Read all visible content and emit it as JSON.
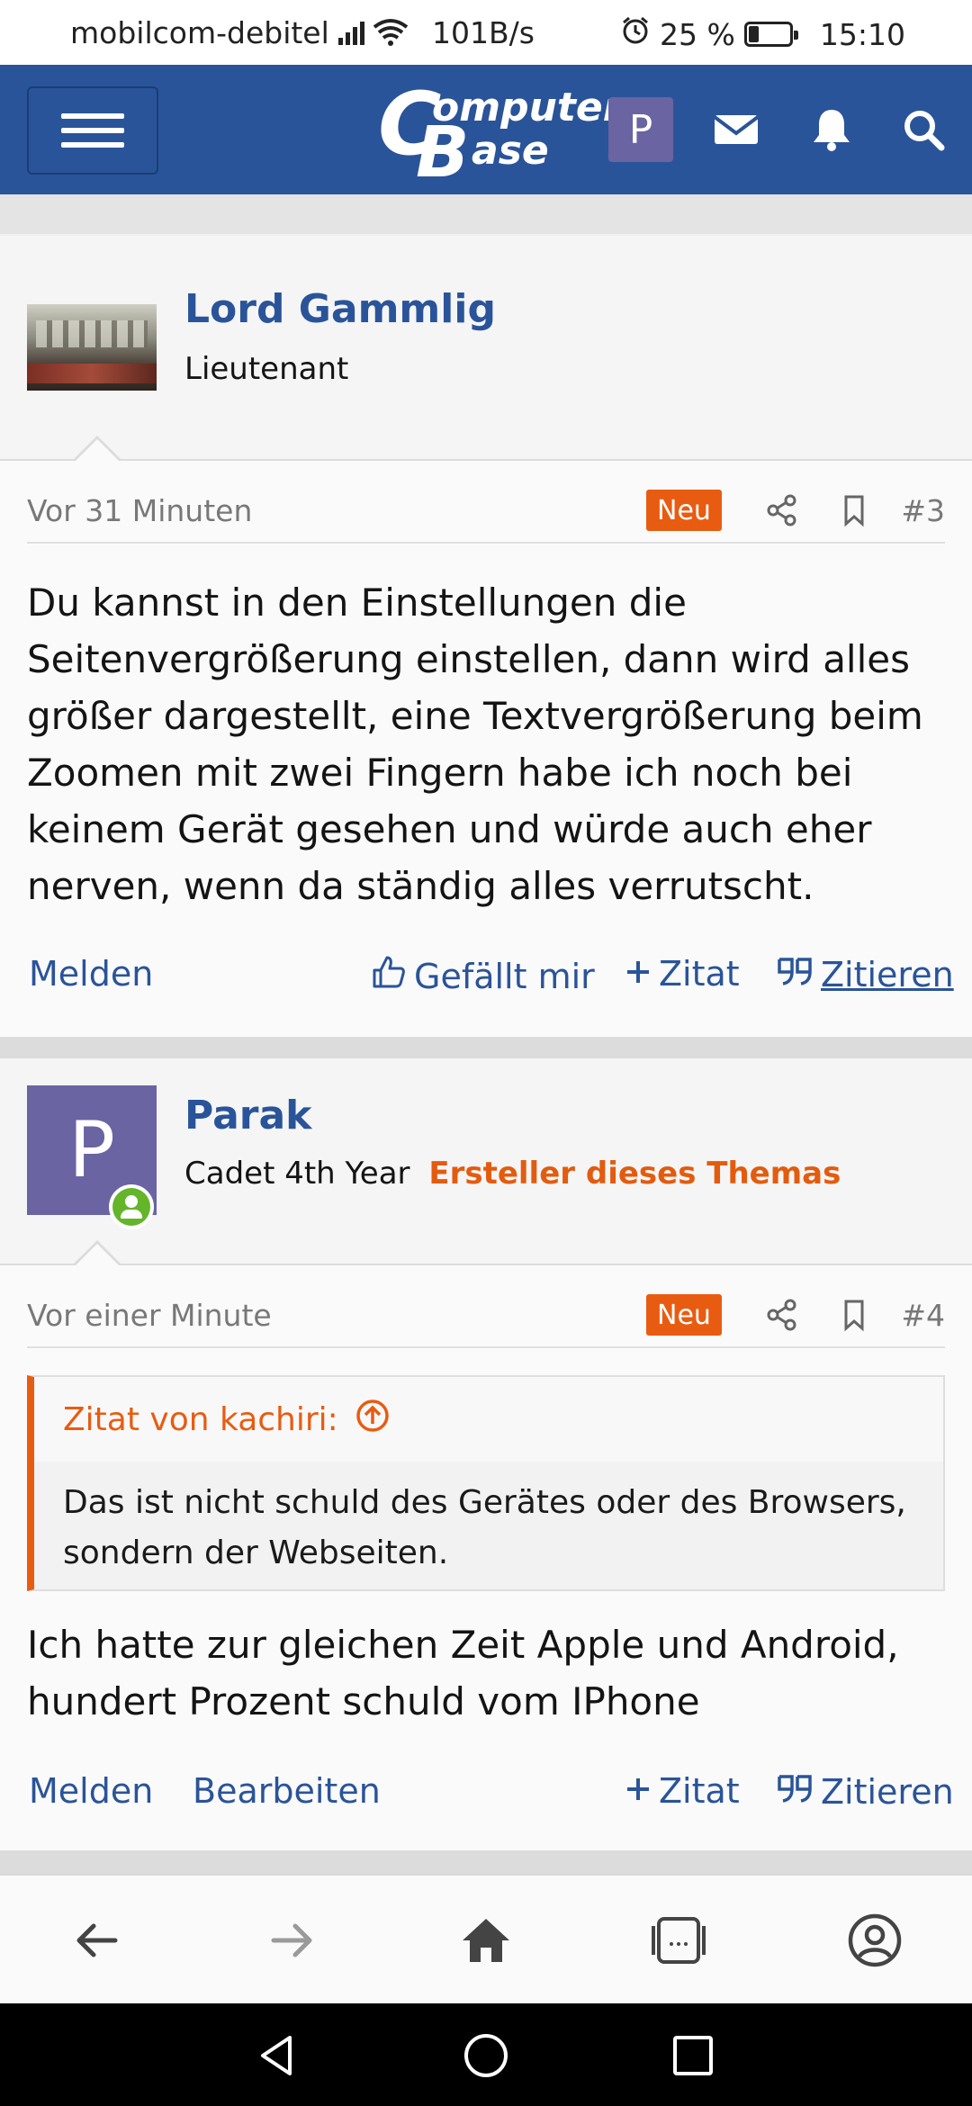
{
  "status": {
    "carrier": "mobilcom-debitel",
    "net_speed": "101B/s",
    "battery": "25 %",
    "battery_level": 0.25,
    "time": "15:10"
  },
  "header": {
    "logo_line1": "omputer",
    "logo_line2": "ase",
    "logo_c": "C",
    "logo_b": "B",
    "user_initial": "P"
  },
  "posts": [
    {
      "author": "Lord Gammlig",
      "rank": "Lieutenant",
      "time": "Vor 31 Minuten",
      "badge": "Neu",
      "number": "#3",
      "text": "Du kannst in den Einstellungen die Seitenvergrößerung einstellen, dann wird alles größer dargestellt, eine Textvergrößerung beim Zoomen mit zwei Fingern habe ich noch bei keinem Gerät gesehen und würde auch eher nerven, wenn da ständig alles verrutscht.",
      "actions": {
        "report": "Melden",
        "like": "Gefällt mir",
        "quote_add": "Zitat",
        "quote": "Zitieren"
      }
    },
    {
      "author": "Parak",
      "avatar_initial": "P",
      "rank": "Cadet 4th Year",
      "op_label": "Ersteller dieses Themas",
      "time": "Vor einer Minute",
      "badge": "Neu",
      "number": "#4",
      "quote_head": "Zitat von kachiri:",
      "quote_text": "Das ist nicht schuld des Gerätes oder des Browsers, sondern der Webseiten.",
      "text": "Ich hatte zur gleichen Zeit Apple und Android, hundert Prozent schuld vom IPhone",
      "actions": {
        "report": "Melden",
        "edit": "Bearbeiten",
        "quote_add": "Zitat",
        "quote": "Zitieren"
      }
    }
  ],
  "colors": {
    "brand": "#2a5499",
    "accent": "#e85c12",
    "online": "#64b52a"
  },
  "icons": [
    "menu-icon",
    "mail-icon",
    "bell-icon",
    "search-icon",
    "share-icon",
    "bookmark-icon",
    "thumbs-up-icon",
    "plus-icon",
    "quote-icon",
    "arrow-up-circle-icon",
    "back-icon",
    "forward-icon",
    "home-icon",
    "tabs-icon",
    "account-icon"
  ]
}
